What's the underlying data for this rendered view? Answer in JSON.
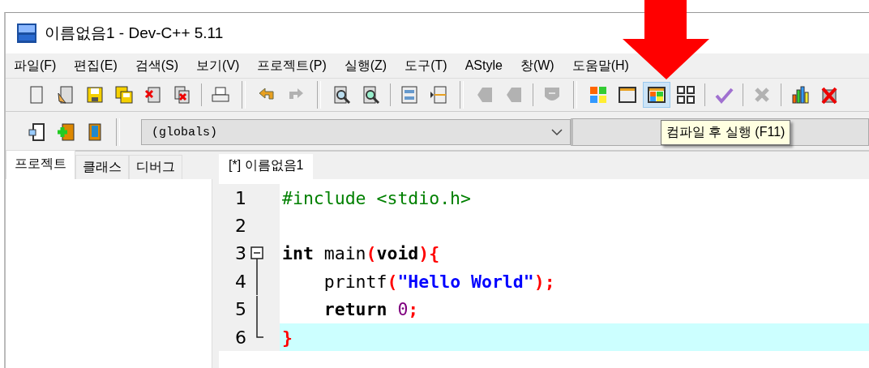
{
  "window": {
    "title": "이름없음1 - Dev-C++ 5.11"
  },
  "menu": [
    {
      "label": "파일(F)"
    },
    {
      "label": "편집(E)"
    },
    {
      "label": "검색(S)"
    },
    {
      "label": "보기(V)"
    },
    {
      "label": "프로젝트(P)"
    },
    {
      "label": "실행(Z)"
    },
    {
      "label": "도구(T)"
    },
    {
      "label": "AStyle"
    },
    {
      "label": "창(W)"
    },
    {
      "label": "도움말(H)"
    }
  ],
  "toolbar": [
    {
      "kind": "new",
      "hovered": false,
      "disabled": false
    },
    {
      "kind": "open",
      "hovered": false,
      "disabled": false
    },
    {
      "kind": "save",
      "hovered": false,
      "disabled": false
    },
    {
      "kind": "saveall",
      "hovered": false,
      "disabled": false
    },
    {
      "kind": "close",
      "hovered": false,
      "disabled": false
    },
    {
      "kind": "closeall",
      "hovered": false,
      "disabled": false
    },
    {
      "kind": "sep"
    },
    {
      "kind": "print",
      "hovered": false,
      "disabled": false
    },
    {
      "kind": "group"
    },
    {
      "kind": "undo",
      "hovered": false,
      "disabled": false
    },
    {
      "kind": "redo",
      "hovered": false,
      "disabled": true
    },
    {
      "kind": "group"
    },
    {
      "kind": "find",
      "hovered": false,
      "disabled": false
    },
    {
      "kind": "replace",
      "hovered": false,
      "disabled": false
    },
    {
      "kind": "sep"
    },
    {
      "kind": "lines",
      "hovered": false,
      "disabled": false
    },
    {
      "kind": "insert",
      "hovered": false,
      "disabled": false
    },
    {
      "kind": "group"
    },
    {
      "kind": "back",
      "hovered": false,
      "disabled": true
    },
    {
      "kind": "back",
      "hovered": false,
      "disabled": true
    },
    {
      "kind": "sep"
    },
    {
      "kind": "shield",
      "hovered": false,
      "disabled": true
    },
    {
      "kind": "group"
    },
    {
      "kind": "compile",
      "hovered": false,
      "disabled": false
    },
    {
      "kind": "run",
      "hovered": false,
      "disabled": false
    },
    {
      "kind": "compilerun",
      "hovered": true,
      "disabled": false
    },
    {
      "kind": "rebuild",
      "hovered": false,
      "disabled": false
    },
    {
      "kind": "sep"
    },
    {
      "kind": "check",
      "hovered": false,
      "disabled": false
    },
    {
      "kind": "sep"
    },
    {
      "kind": "stop",
      "hovered": false,
      "disabled": true
    },
    {
      "kind": "sep"
    },
    {
      "kind": "chart",
      "hovered": false,
      "disabled": false
    },
    {
      "kind": "debugx",
      "hovered": false,
      "disabled": false
    }
  ],
  "toolbar2": [
    {
      "kind": "project",
      "hovered": false,
      "disabled": false
    },
    {
      "kind": "addfile",
      "hovered": false,
      "disabled": false
    },
    {
      "kind": "book",
      "hovered": false,
      "disabled": false
    }
  ],
  "scope_combo": {
    "value": "(globals)"
  },
  "tooltip": {
    "text": "컴파일 후 실행 (F11)"
  },
  "side_tabs": [
    {
      "label": "프로젝트",
      "selected": true
    },
    {
      "label": "클래스",
      "selected": false
    },
    {
      "label": "디버그",
      "selected": false
    }
  ],
  "editor_tabs": [
    {
      "label": "[*] 이름없음1",
      "selected": true
    }
  ],
  "code": [
    {
      "number": "1",
      "kind": "plain",
      "current": false,
      "tokens": [
        {
          "kind": "preprocessor",
          "text": "#include <stdio.h>"
        }
      ]
    },
    {
      "number": "2",
      "kind": "plain",
      "current": false
    },
    {
      "number": "3",
      "kind": "fold_start",
      "current": false,
      "tokens": [
        {
          "kind": "keyword",
          "text": "int"
        },
        {
          "kind": "plain",
          "text": " main"
        },
        {
          "kind": "symbol",
          "text": "("
        },
        {
          "kind": "keyword",
          "text": "void"
        },
        {
          "kind": "symbol",
          "text": "){"
        }
      ]
    },
    {
      "number": "4",
      "kind": "fold_body",
      "current": false,
      "tokens": [
        {
          "kind": "plain",
          "text": "    printf"
        },
        {
          "kind": "symbol",
          "text": "("
        },
        {
          "kind": "string",
          "text": "\"Hello World\""
        },
        {
          "kind": "symbol",
          "text": ");"
        }
      ]
    },
    {
      "number": "5",
      "kind": "fold_body",
      "current": false,
      "tokens": [
        {
          "kind": "keyword",
          "text": "    return "
        },
        {
          "kind": "number",
          "text": "0"
        },
        {
          "kind": "symbol",
          "text": ";"
        }
      ]
    },
    {
      "number": "6",
      "kind": "fold_end",
      "current": true,
      "tokens": [
        {
          "kind": "symbol",
          "text": "}"
        }
      ]
    }
  ]
}
